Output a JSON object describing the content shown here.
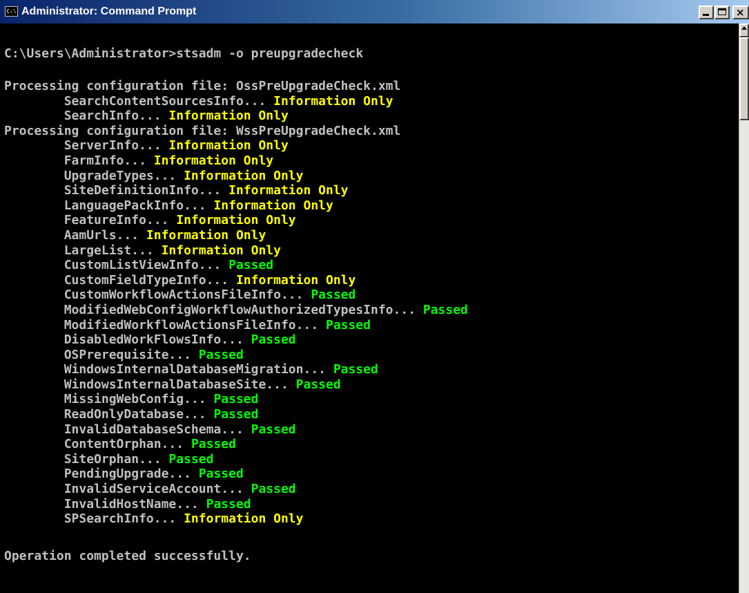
{
  "window": {
    "title": "Administrator: Command Prompt",
    "icon_label": "C:\\",
    "title_icon": "console-icon"
  },
  "colors": {
    "title_gradient_start": "#0a246a",
    "title_gradient_end": "#a6caf0",
    "console_bg": "#000000",
    "text_default": "#c0c0c0",
    "status_information_only": "#ffff00",
    "status_passed": "#00ff00"
  },
  "console": {
    "command_line": "C:\\Users\\Administrator>stsadm -o preupgradecheck",
    "lines": [
      {
        "indent": false,
        "label": "Processing configuration file: OssPreUpgradeCheck.xml",
        "status": "",
        "status_type": "none"
      },
      {
        "indent": true,
        "label": "SearchContentSourcesInfo... ",
        "status": "Information Only",
        "status_type": "info"
      },
      {
        "indent": true,
        "label": "SearchInfo... ",
        "status": "Information Only",
        "status_type": "info"
      },
      {
        "indent": false,
        "label": "Processing configuration file: WssPreUpgradeCheck.xml",
        "status": "",
        "status_type": "none"
      },
      {
        "indent": true,
        "label": "ServerInfo... ",
        "status": "Information Only",
        "status_type": "info"
      },
      {
        "indent": true,
        "label": "FarmInfo... ",
        "status": "Information Only",
        "status_type": "info"
      },
      {
        "indent": true,
        "label": "UpgradeTypes... ",
        "status": "Information Only",
        "status_type": "info"
      },
      {
        "indent": true,
        "label": "SiteDefinitionInfo... ",
        "status": "Information Only",
        "status_type": "info"
      },
      {
        "indent": true,
        "label": "LanguagePackInfo... ",
        "status": "Information Only",
        "status_type": "info"
      },
      {
        "indent": true,
        "label": "FeatureInfo... ",
        "status": "Information Only",
        "status_type": "info"
      },
      {
        "indent": true,
        "label": "AamUrls... ",
        "status": "Information Only",
        "status_type": "info"
      },
      {
        "indent": true,
        "label": "LargeList... ",
        "status": "Information Only",
        "status_type": "info"
      },
      {
        "indent": true,
        "label": "CustomListViewInfo... ",
        "status": "Passed",
        "status_type": "pass"
      },
      {
        "indent": true,
        "label": "CustomFieldTypeInfo... ",
        "status": "Information Only",
        "status_type": "info"
      },
      {
        "indent": true,
        "label": "CustomWorkflowActionsFileInfo... ",
        "status": "Passed",
        "status_type": "pass"
      },
      {
        "indent": true,
        "label": "ModifiedWebConfigWorkflowAuthorizedTypesInfo... ",
        "status": "Passed",
        "status_type": "pass"
      },
      {
        "indent": true,
        "label": "ModifiedWorkflowActionsFileInfo... ",
        "status": "Passed",
        "status_type": "pass"
      },
      {
        "indent": true,
        "label": "DisabledWorkFlowsInfo... ",
        "status": "Passed",
        "status_type": "pass"
      },
      {
        "indent": true,
        "label": "OSPrerequisite... ",
        "status": "Passed",
        "status_type": "pass"
      },
      {
        "indent": true,
        "label": "WindowsInternalDatabaseMigration... ",
        "status": "Passed",
        "status_type": "pass"
      },
      {
        "indent": true,
        "label": "WindowsInternalDatabaseSite... ",
        "status": "Passed",
        "status_type": "pass"
      },
      {
        "indent": true,
        "label": "MissingWebConfig... ",
        "status": "Passed",
        "status_type": "pass"
      },
      {
        "indent": true,
        "label": "ReadOnlyDatabase... ",
        "status": "Passed",
        "status_type": "pass"
      },
      {
        "indent": true,
        "label": "InvalidDatabaseSchema... ",
        "status": "Passed",
        "status_type": "pass"
      },
      {
        "indent": true,
        "label": "ContentOrphan... ",
        "status": "Passed",
        "status_type": "pass"
      },
      {
        "indent": true,
        "label": "SiteOrphan... ",
        "status": "Passed",
        "status_type": "pass"
      },
      {
        "indent": true,
        "label": "PendingUpgrade... ",
        "status": "Passed",
        "status_type": "pass"
      },
      {
        "indent": true,
        "label": "InvalidServiceAccount... ",
        "status": "Passed",
        "status_type": "pass"
      },
      {
        "indent": true,
        "label": "InvalidHostName... ",
        "status": "Passed",
        "status_type": "pass"
      },
      {
        "indent": true,
        "label": "SPSearchInfo... ",
        "status": "Information Only",
        "status_type": "info"
      }
    ],
    "final_message": "Operation completed successfully."
  },
  "controls": {
    "minimize_icon": "minimize-icon",
    "maximize_icon": "maximize-icon",
    "close_icon": "close-icon",
    "scroll_up_icon": "scroll-up-arrow-icon"
  }
}
